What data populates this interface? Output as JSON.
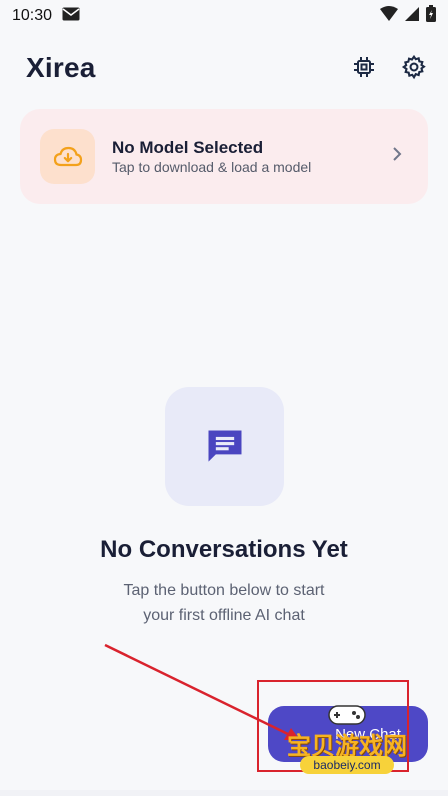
{
  "status": {
    "time": "10:30"
  },
  "app": {
    "title": "Xirea"
  },
  "model_card": {
    "title": "No Model Selected",
    "subtitle": "Tap to download & load a model"
  },
  "empty_state": {
    "title": "No Conversations Yet",
    "subtitle_line1": "Tap the button below to start",
    "subtitle_line2": "your first offline AI chat"
  },
  "fab": {
    "label": "New Chat"
  },
  "watermark": {
    "cn": "宝贝游戏网",
    "url": "baobeiy.com"
  },
  "colors": {
    "accent": "#4e48c6",
    "card_bg": "#fbecee",
    "cloud_tile": "#fde0cd",
    "annotation": "#d9232d"
  }
}
